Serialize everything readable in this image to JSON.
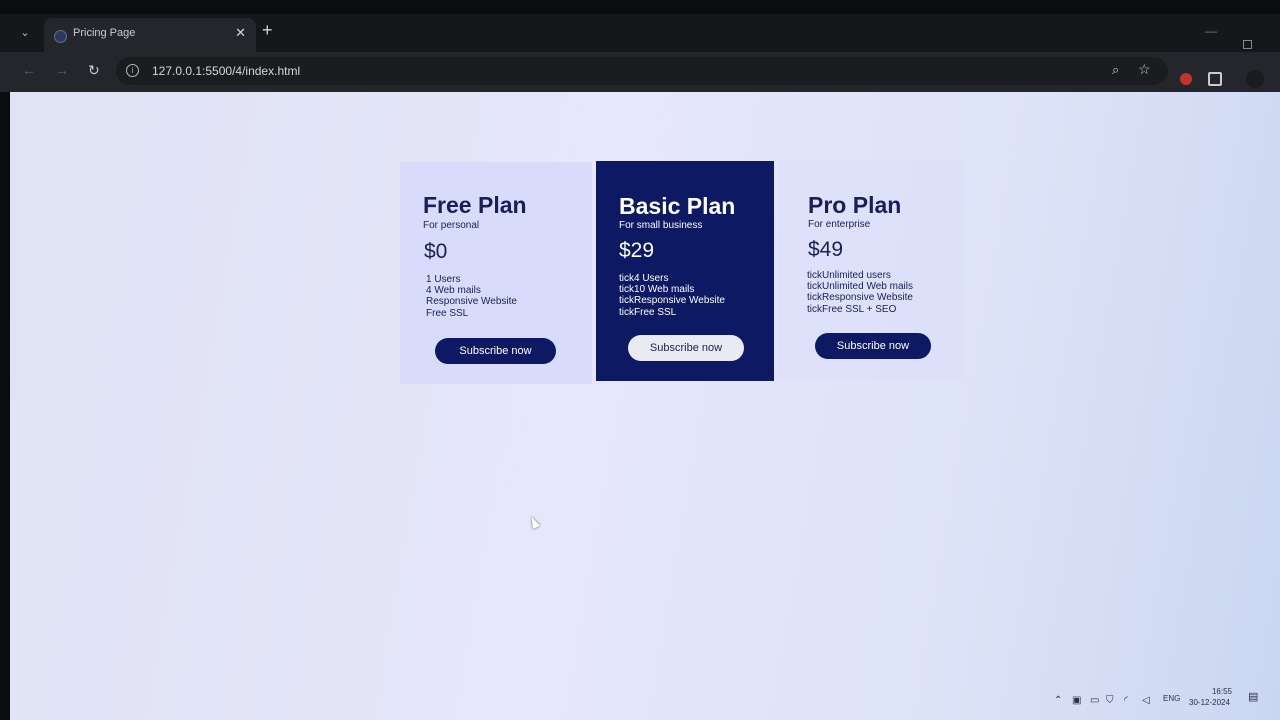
{
  "browser": {
    "tab_title": "Pricing Page",
    "tab_close": "✕",
    "new_tab": "+",
    "url": "127.0.0.1:5500/4/index.html"
  },
  "plans": [
    {
      "title": "Free Plan",
      "subtitle": "For personal",
      "price": "$0",
      "features": [
        "1 Users",
        "4 Web mails",
        "Responsive Website",
        "Free SSL"
      ],
      "button": "Subscribe now"
    },
    {
      "title": "Basic Plan",
      "subtitle": "For small business",
      "price": "$29",
      "features": [
        "tick4 Users",
        "tick10 Web mails",
        "tickResponsive Website",
        "tickFree SSL"
      ],
      "button": "Subscribe now"
    },
    {
      "title": "Pro Plan",
      "subtitle": "For enterprise",
      "price": "$49",
      "features": [
        "tickUnlimited users",
        "tickUnlimited Web mails",
        "tickResponsive Website",
        "tickFree SSL + SEO"
      ],
      "button": "Subscribe now"
    }
  ],
  "taskbar": {
    "lang": "ENG",
    "time": "16:55",
    "date": "30-12-2024"
  },
  "colors": {
    "accent": "#0d1a63",
    "page_background": "#e4e6f8"
  }
}
